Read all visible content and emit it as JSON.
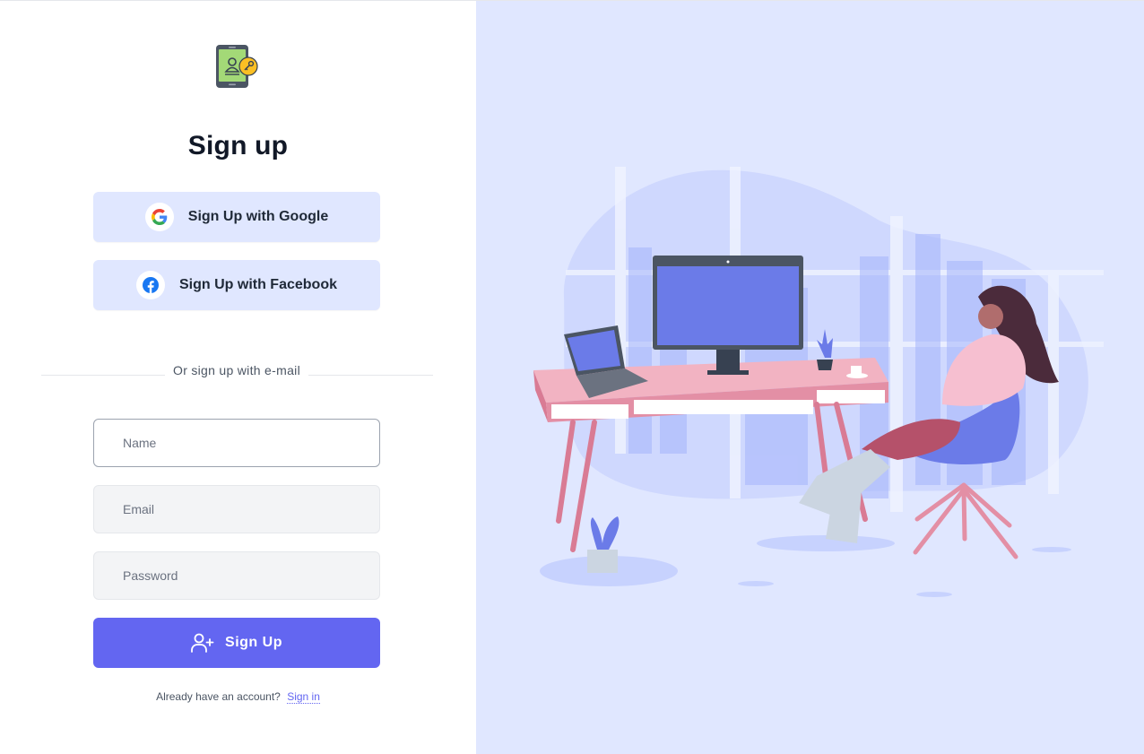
{
  "form": {
    "title": "Sign up",
    "google_label": "Sign Up with Google",
    "facebook_label": "Sign Up with Facebook",
    "divider_text": "Or sign up with e-mail",
    "name_placeholder": "Name",
    "email_placeholder": "Email",
    "password_placeholder": "Password",
    "submit_label": "Sign Up",
    "footer_text": "Already have an account?",
    "signin_link": "Sign in"
  },
  "colors": {
    "accent": "#6366f1",
    "panel_background": "#e0e7ff",
    "social_button_background": "#e0e7ff"
  },
  "icons": {
    "logo": "phone-id-key-icon",
    "google": "google-icon",
    "facebook": "facebook-icon",
    "submit": "user-plus-icon"
  }
}
